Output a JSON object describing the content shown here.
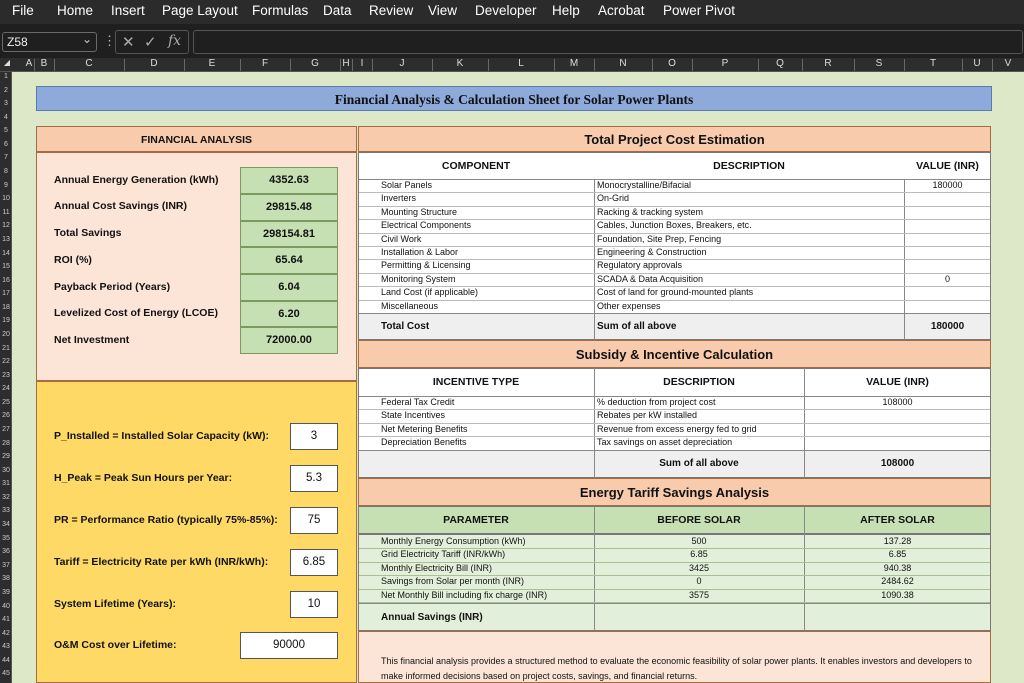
{
  "menu": [
    "File",
    "Home",
    "Insert",
    "Page Layout",
    "Formulas",
    "Data",
    "Review",
    "View",
    "Developer",
    "Help",
    "Acrobat",
    "Power Pivot"
  ],
  "formula_bar": {
    "name_box": "Z58",
    "fx": "fx",
    "cancel": "✕",
    "enter": "✓",
    "value": ""
  },
  "columns": [
    "A",
    "B",
    "C",
    "D",
    "E",
    "F",
    "G",
    "H",
    "I",
    "J",
    "K",
    "L",
    "M",
    "N",
    "O",
    "P",
    "Q",
    "R",
    "S",
    "T",
    "U",
    "V"
  ],
  "rows": [
    "1",
    "2",
    "3",
    "4",
    "5",
    "6",
    "7",
    "8",
    "9",
    "10",
    "11",
    "12",
    "13",
    "14",
    "15",
    "16",
    "17",
    "18",
    "19",
    "20",
    "21",
    "22",
    "23",
    "24",
    "25",
    "26",
    "27",
    "28",
    "29",
    "30",
    "31",
    "32",
    "33",
    "34",
    "35",
    "36",
    "37",
    "38",
    "39",
    "40",
    "41",
    "42",
    "43",
    "44",
    "45"
  ],
  "title": "Financial Analysis & Calculation Sheet for Solar Power Plants",
  "financial": {
    "header": "FINANCIAL ANALYSIS",
    "items": [
      {
        "label": "Annual Energy Generation (kWh)",
        "value": "4352.63"
      },
      {
        "label": "Annual Cost Savings (INR)",
        "value": "29815.48"
      },
      {
        "label": "Total Savings",
        "value": "298154.81"
      },
      {
        "label": "ROI (%)",
        "value": "65.64"
      },
      {
        "label": "Payback Period (Years)",
        "value": "6.04"
      },
      {
        "label": "Levelized Cost of Energy (LCOE)",
        "value": "6.20"
      },
      {
        "label": "Net Investment",
        "value": "72000.00"
      }
    ]
  },
  "inputs": [
    {
      "label": "P_Installed = Installed Solar Capacity (kW):",
      "value": "3"
    },
    {
      "label": "H_Peak = Peak Sun Hours per Year:",
      "value": "5.3"
    },
    {
      "label": "PR = Performance Ratio (typically 75%-85%):",
      "value": "75"
    },
    {
      "label": "Tariff = Electricity Rate per kWh (INR/kWh):",
      "value": "6.85"
    },
    {
      "label": "System Lifetime (Years):",
      "value": "10"
    },
    {
      "label": "O&M Cost over Lifetime:",
      "value": "90000"
    }
  ],
  "cost": {
    "header": "Total Project Cost Estimation",
    "columns": [
      "COMPONENT",
      "DESCRIPTION",
      "VALUE (INR)"
    ],
    "rows": [
      {
        "component": "Solar Panels",
        "description": "Monocrystalline/Bifacial",
        "value": "180000"
      },
      {
        "component": "Inverters",
        "description": "On-Grid",
        "value": ""
      },
      {
        "component": "Mounting Structure",
        "description": "Racking & tracking system",
        "value": ""
      },
      {
        "component": "Electrical Components",
        "description": "Cables, Junction Boxes, Breakers, etc.",
        "value": ""
      },
      {
        "component": "Civil Work",
        "description": "Foundation, Site Prep, Fencing",
        "value": ""
      },
      {
        "component": "Installation & Labor",
        "description": "Engineering & Construction",
        "value": ""
      },
      {
        "component": "Permitting & Licensing",
        "description": "Regulatory approvals",
        "value": ""
      },
      {
        "component": "Monitoring System",
        "description": "SCADA & Data Acquisition",
        "value": "0"
      },
      {
        "component": "Land Cost (if applicable)",
        "description": "Cost of land for ground-mounted plants",
        "value": ""
      },
      {
        "component": "Miscellaneous",
        "description": "Other expenses",
        "value": ""
      }
    ],
    "total": {
      "label": "Total Cost",
      "description": "Sum of all above",
      "value": "180000"
    }
  },
  "subsidy": {
    "header": "Subsidy & Incentive Calculation",
    "columns": [
      "INCENTIVE TYPE",
      "DESCRIPTION",
      "VALUE (INR)"
    ],
    "rows": [
      {
        "type": "Federal Tax Credit",
        "description": "% deduction from project cost",
        "value": "108000"
      },
      {
        "type": "State Incentives",
        "description": "Rebates per kW installed",
        "value": ""
      },
      {
        "type": "Net Metering Benefits",
        "description": "Revenue from excess energy fed to grid",
        "value": ""
      },
      {
        "type": "Depreciation Benefits",
        "description": "Tax savings on asset depreciation",
        "value": ""
      }
    ],
    "total": {
      "label": "Sum of all above",
      "value": "108000"
    }
  },
  "tariff": {
    "header": "Energy Tariff Savings Analysis",
    "columns": [
      "PARAMETER",
      "BEFORE SOLAR",
      "AFTER SOLAR"
    ],
    "rows": [
      {
        "param": "Monthly Energy Consumption (kWh)",
        "before": "500",
        "after": "137.28"
      },
      {
        "param": "Grid Electricity Tariff (INR/kWh)",
        "before": "6.85",
        "after": "6.85"
      },
      {
        "param": "Monthly Electricity Bill (INR)",
        "before": "3425",
        "after": "940.38"
      },
      {
        "param": "Savings from Solar per month (INR)",
        "before": "0",
        "after": "2484.62"
      },
      {
        "param": "Net Monthly Bill including fix charge (INR)",
        "before": "3575",
        "after": "1090.38"
      }
    ],
    "annual": {
      "label": "Annual Savings (INR)"
    }
  },
  "note": "This financial analysis provides a structured method to evaluate the economic feasibility of solar power plants. It enables investors and developers to make informed decisions based on project costs, savings, and financial returns."
}
